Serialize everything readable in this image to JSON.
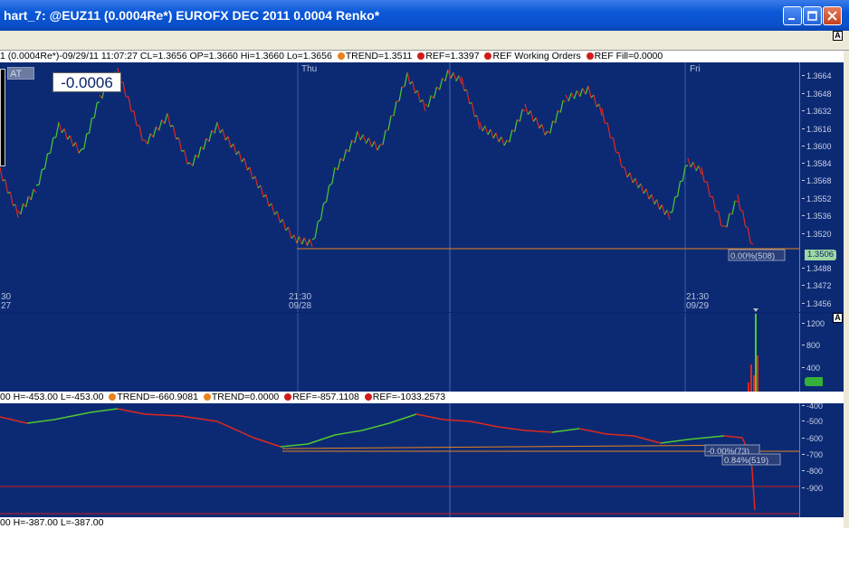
{
  "window": {
    "title": "hart_7: @EUZ11 (0.0004Re*) EUROFX DEC 2011 0.0004 Renko*",
    "accent": "#0a58d8"
  },
  "price_pane": {
    "info_segments": [
      {
        "text": "1 (0.0004Re*)-09/29/11 11:07:27 CL=1.3656 OP=1.3660 Hi=1.3660 Lo=1.3656 ",
        "dot": ""
      },
      {
        "text": "TREND=1.3511 ",
        "dot": "orange"
      },
      {
        "text": "REF=1.3397 ",
        "dot": "red"
      },
      {
        "text": "REF Working Orders ",
        "dot": "red"
      },
      {
        "text": "REF Fill=0.0000",
        "dot": "red"
      }
    ],
    "big_value": "-0.0006",
    "at_label": "AT",
    "day_labels": [
      "Thu",
      "Fri"
    ],
    "time_labels": [
      {
        "time": "30",
        "date": "27"
      },
      {
        "time": "21:30",
        "date": "09/28"
      },
      {
        "time": "21:30",
        "date": "09/29"
      }
    ],
    "y_ticks": [
      "1.3664",
      "1.3648",
      "1.3632",
      "1.3616",
      "1.3600",
      "1.3584",
      "1.3568",
      "1.3552",
      "1.3536",
      "1.3520",
      "1.3488",
      "1.3472",
      "1.3456"
    ],
    "last_price": "1.3506",
    "ref_tag": "0.00%(508)",
    "axis_marker": "A",
    "colors": {
      "up": "#4fc832",
      "down": "#e0281e",
      "ref_line": "#e8821e"
    }
  },
  "volume_pane": {
    "y_ticks": [
      "1200",
      "800",
      "400"
    ],
    "axis_marker": "A"
  },
  "indicator_pane": {
    "info_segments": [
      {
        "text": "00 H=-453.00 L=-453.00 ",
        "dot": ""
      },
      {
        "text": "TREND=-660.9081 ",
        "dot": "orange"
      },
      {
        "text": "TREND=0.0000 ",
        "dot": "orange"
      },
      {
        "text": "REF=-857.1108 ",
        "dot": "red"
      },
      {
        "text": "REF=-1033.2573",
        "dot": "red"
      }
    ],
    "y_ticks": [
      "-400",
      "-500",
      "-600",
      "-700",
      "-800",
      "-900"
    ],
    "tags": [
      "-0.00%(73)",
      "0.84%(519)"
    ],
    "footer": "00 H=-387.00 L=-387.00"
  }
}
